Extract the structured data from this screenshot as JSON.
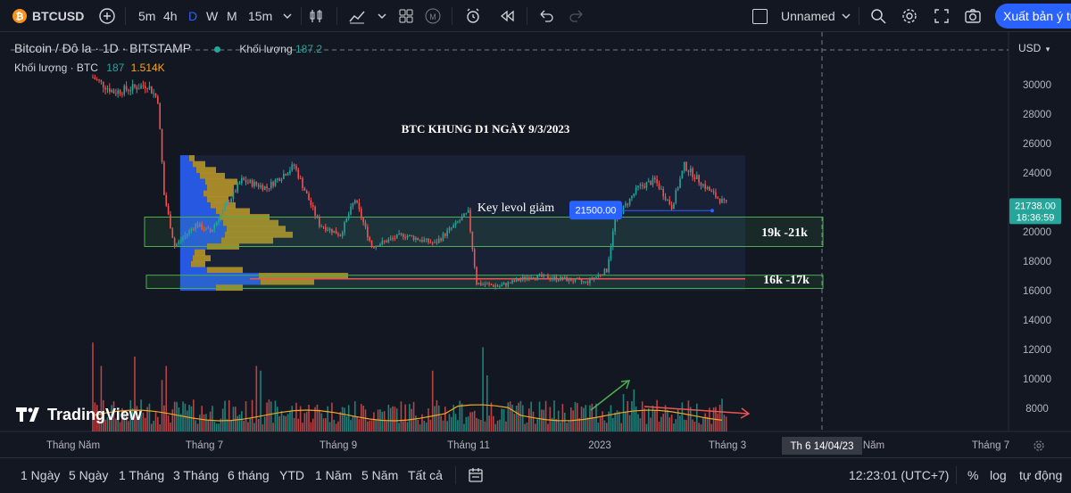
{
  "toolbar": {
    "symbol": "BTCUSD",
    "intervals": [
      "5m",
      "4h",
      "D",
      "W",
      "M",
      "15m"
    ],
    "active_interval": "D",
    "layout_name": "Unnamed",
    "export_label": "Xuất bản ý tưởng"
  },
  "legend": {
    "title": "Bitcoin / Đô la · 1D · BITSTAMP",
    "volume_line": "Khối lượng · BTC",
    "volume_val1": "187",
    "volume_val2": "1.514K",
    "volume_indicator_label": "Khối lượng",
    "volume_indicator_value": "187.2"
  },
  "currency": "USD",
  "price_label": {
    "value": "21738.00",
    "countdown": "18:36:59"
  },
  "crosshair_date": "Th 6 14/04/23",
  "bottom": {
    "ranges": [
      "1 Ngày",
      "5 Ngày",
      "1 Tháng",
      "3 Tháng",
      "6 tháng",
      "YTD",
      "1 Năm",
      "5 Năm",
      "Tất cả"
    ],
    "time": "12:23:01 (UTC+7)",
    "percent": "%",
    "log": "log",
    "auto": "tự động"
  },
  "brand": "TradingView",
  "chart_data": {
    "type": "candlestick",
    "symbol": "Bitcoin / Đô la",
    "interval": "1D",
    "exchange": "BITSTAMP",
    "y_axis_ticks": [
      8000,
      10000,
      12000,
      14000,
      16000,
      18000,
      20000,
      22000,
      24000,
      26000,
      28000,
      30000
    ],
    "ylim": [
      7000,
      33000
    ],
    "x_axis_ticks": [
      "Tháng Năm",
      "Tháng 7",
      "Tháng 9",
      "Tháng 11",
      "2023",
      "Tháng 3",
      "Năm",
      "Tháng 7"
    ],
    "price_path": [
      {
        "t": "2022-05-10",
        "p": 30500
      },
      {
        "t": "2022-05-20",
        "p": 29500
      },
      {
        "t": "2022-06-05",
        "p": 30000
      },
      {
        "t": "2022-06-10",
        "p": 29000
      },
      {
        "t": "2022-06-13",
        "p": 22500
      },
      {
        "t": "2022-06-18",
        "p": 19000
      },
      {
        "t": "2022-06-28",
        "p": 20500
      },
      {
        "t": "2022-07-05",
        "p": 20000
      },
      {
        "t": "2022-07-20",
        "p": 23500
      },
      {
        "t": "2022-08-01",
        "p": 23000
      },
      {
        "t": "2022-08-14",
        "p": 24500
      },
      {
        "t": "2022-08-26",
        "p": 20500
      },
      {
        "t": "2022-09-05",
        "p": 19800
      },
      {
        "t": "2022-09-12",
        "p": 22200
      },
      {
        "t": "2022-09-20",
        "p": 19000
      },
      {
        "t": "2022-10-05",
        "p": 19800
      },
      {
        "t": "2022-10-20",
        "p": 19200
      },
      {
        "t": "2022-11-05",
        "p": 21300
      },
      {
        "t": "2022-11-09",
        "p": 16500
      },
      {
        "t": "2022-11-20",
        "p": 16300
      },
      {
        "t": "2022-12-05",
        "p": 17000
      },
      {
        "t": "2022-12-20",
        "p": 16800
      },
      {
        "t": "2022-12-31",
        "p": 16550
      },
      {
        "t": "2023-01-10",
        "p": 17400
      },
      {
        "t": "2023-01-14",
        "p": 20800
      },
      {
        "t": "2023-01-25",
        "p": 23000
      },
      {
        "t": "2023-02-02",
        "p": 23500
      },
      {
        "t": "2023-02-10",
        "p": 21700
      },
      {
        "t": "2023-02-16",
        "p": 24500
      },
      {
        "t": "2023-02-25",
        "p": 23200
      },
      {
        "t": "2023-03-03",
        "p": 22400
      },
      {
        "t": "2023-03-09",
        "p": 21738
      }
    ],
    "annotations": [
      {
        "text": "BTC KHUNG D1 NGÀY 9/3/2023",
        "type": "title"
      },
      {
        "text": "Key levol giảm",
        "type": "label"
      },
      {
        "text": "21500.00",
        "type": "price-tag",
        "price": 21500
      },
      {
        "text": "19k -21k",
        "type": "zone",
        "from": 19000,
        "to": 21000
      },
      {
        "text": "16k -17k",
        "type": "zone",
        "from": 16150,
        "to": 17050
      }
    ],
    "volume_profile": {
      "range": [
        16000,
        25200
      ]
    },
    "colors": {
      "up": "#26a69a",
      "down": "#ef5350",
      "zone": "#4caf50",
      "accent": "#2962ff",
      "profile_up": "#2962ff",
      "profile_down": "#c9a227"
    }
  }
}
